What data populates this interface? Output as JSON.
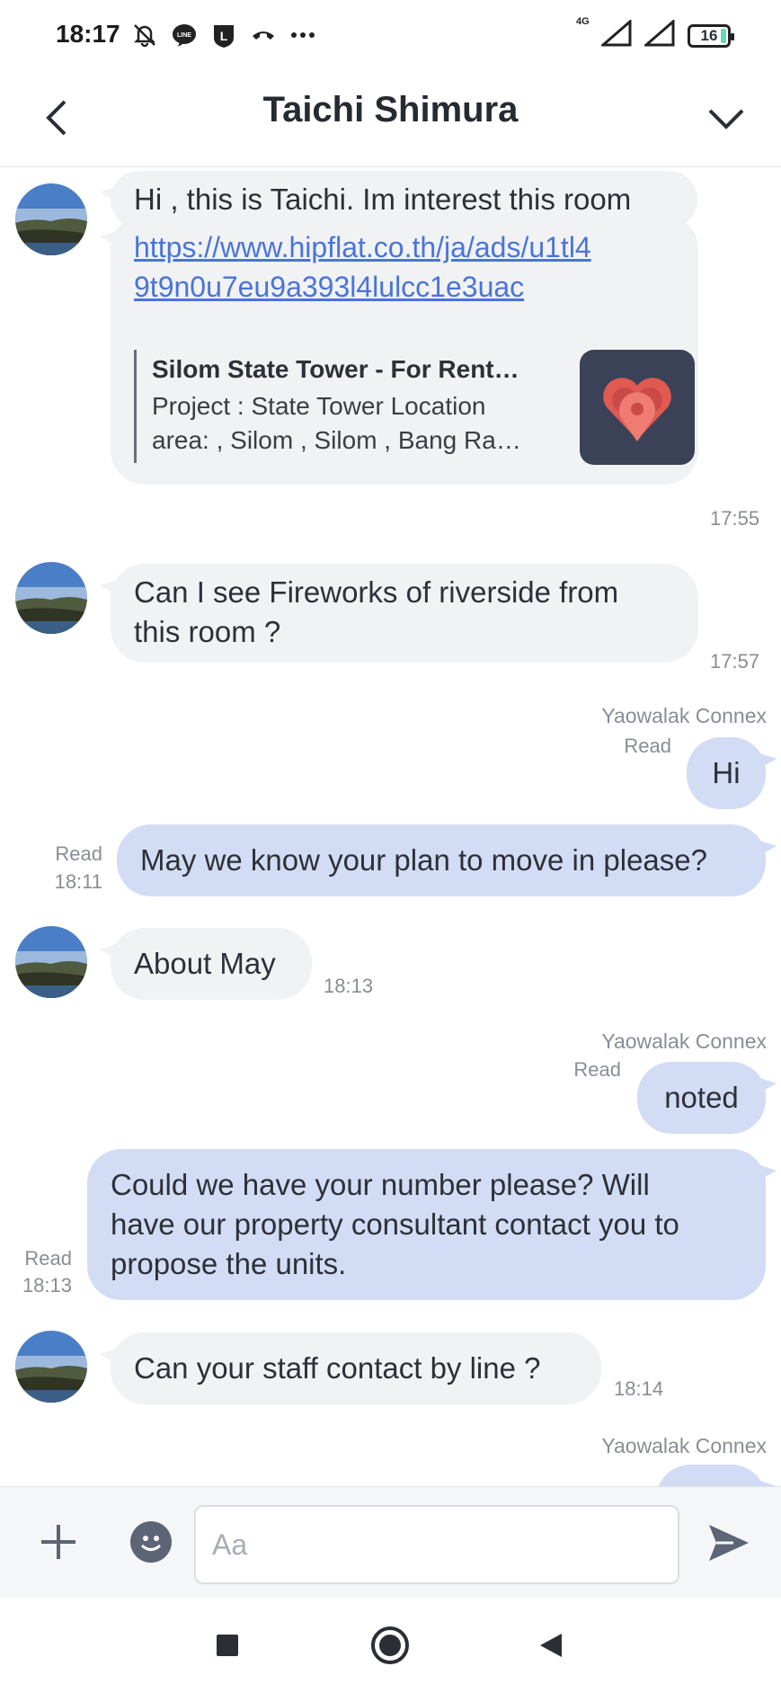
{
  "status_bar": {
    "time": "18:17",
    "network": "4G",
    "battery": "16",
    "notification_icons": [
      "mute-icon",
      "line-icon",
      "l-app-icon",
      "call-icon",
      "more-dots-icon"
    ]
  },
  "header": {
    "title": "Taichi Shimura"
  },
  "messages": [
    {
      "type": "in",
      "text": "Hi , this is Taichi. Im interest this room"
    },
    {
      "type": "in-link",
      "link": "https://www.hipflat.co.th/ja/ads/u1tl49t9n0u7eu9a393l4lulcc1e3uac",
      "link_line1": "https://www.hipflat.co.th/ja/ads/u1tl4",
      "link_line2": "9t9n0u7eu9a393l4lulcc1e3uac",
      "preview_title": "Silom State Tower - For Rent…",
      "preview_desc_line1": "Project : State Tower Location",
      "preview_desc_line2": "area: , Silom , Silom , Bang Ra…",
      "time": "17:55"
    },
    {
      "type": "in",
      "line1": "Can I see Fireworks of riverside from",
      "line2": "this room ?",
      "time": "17:57"
    },
    {
      "type": "sender",
      "name": "Yaowalak Connex"
    },
    {
      "type": "out",
      "text": "Hi",
      "read": "Read"
    },
    {
      "type": "out",
      "text": "May we know your plan to move in please?",
      "read": "Read",
      "time": "18:11"
    },
    {
      "type": "in",
      "text": "About May",
      "time": "18:13"
    },
    {
      "type": "sender",
      "name": "Yaowalak Connex"
    },
    {
      "type": "out",
      "text": "noted",
      "read": "Read"
    },
    {
      "type": "out",
      "line1": "Could we have your number please? Will",
      "line2": "have our property consultant contact you to",
      "line3": "propose the units.",
      "read": "Read",
      "time": "18:13"
    },
    {
      "type": "in",
      "text": "Can your staff contact by line ?",
      "time": "18:14"
    },
    {
      "type": "sender",
      "name": "Yaowalak Connex"
    }
  ],
  "input": {
    "placeholder": "Aa",
    "value": ""
  },
  "colors": {
    "incoming_bubble": "#f1f2f4",
    "outgoing_bubble": "#d3dcf5",
    "link": "#4a74d9",
    "icon_dark": "#5d6475"
  },
  "nav": {
    "icons": [
      "recents-square-icon",
      "home-circle-icon",
      "back-triangle-icon"
    ]
  }
}
